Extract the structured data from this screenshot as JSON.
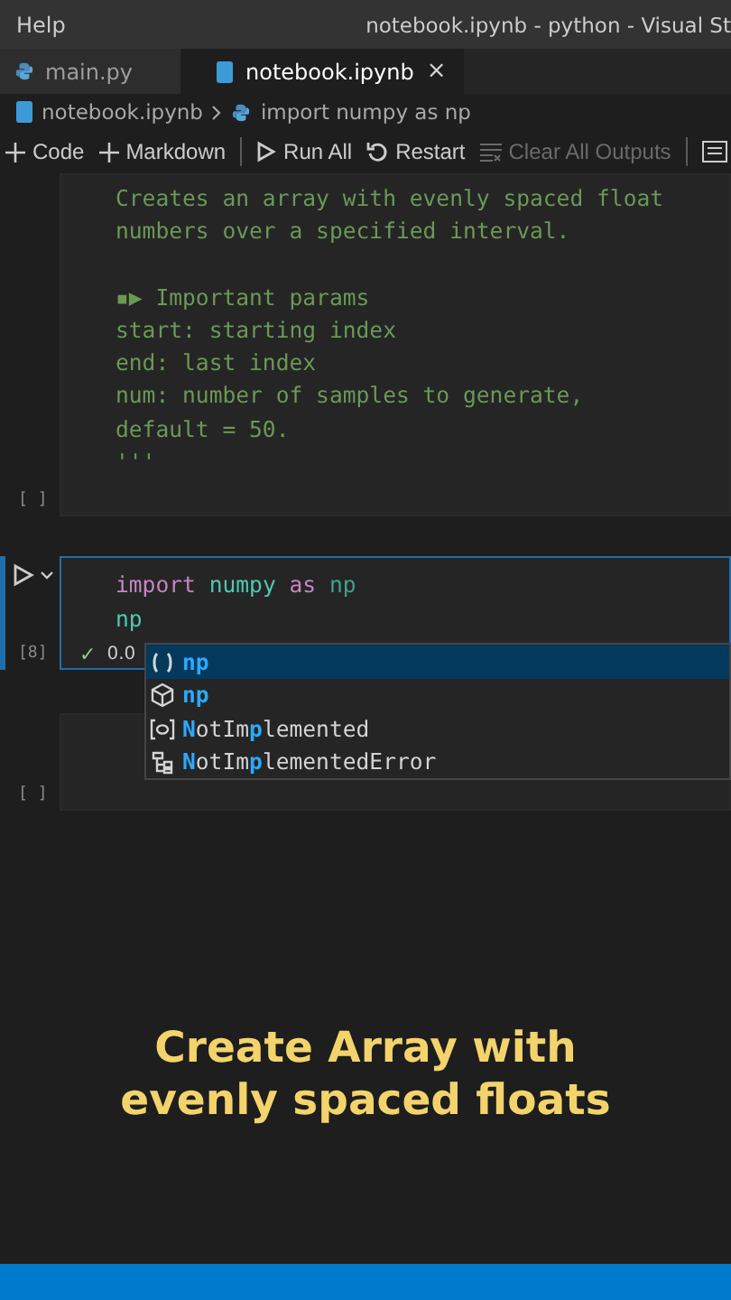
{
  "title_bar": {
    "menu": "Help",
    "title": "notebook.ipynb - python - Visual St"
  },
  "tabs": [
    {
      "label": "main.py",
      "kind": "python",
      "selected": false
    },
    {
      "label": "notebook.ipynb",
      "kind": "notebook",
      "selected": true,
      "close": "×"
    }
  ],
  "breadcrumb": [
    {
      "label": "notebook.ipynb",
      "kind": "notebook"
    },
    {
      "label": "import numpy as np",
      "kind": "python"
    }
  ],
  "toolbar": [
    {
      "kind": "add",
      "label": "Code",
      "disabled": false
    },
    {
      "kind": "add",
      "label": "Markdown",
      "disabled": false
    },
    {
      "kind": "separator"
    },
    {
      "kind": "run",
      "label": "Run All",
      "disabled": false
    },
    {
      "kind": "restart",
      "label": "Restart",
      "disabled": false
    },
    {
      "kind": "clear",
      "label": "Clear All Outputs",
      "disabled": true
    },
    {
      "kind": "separator"
    },
    {
      "kind": "variables"
    }
  ],
  "cells": [
    {
      "kind": "text",
      "paragraphs": [
        [
          "Creates an array with evenly spaced float",
          "numbers over a specified interval."
        ],
        [
          "▪▶ Important params",
          "start: starting index",
          "end: last index",
          "num: number of samples to generate,",
          "default = 50.",
          "'''"
        ]
      ],
      "count": "[ ]",
      "focused": false
    },
    {
      "kind": "code",
      "lines": [
        [
          {
            "text": "import ",
            "kind": "keyword"
          },
          {
            "text": "numpy ",
            "kind": "module"
          },
          {
            "text": "as ",
            "kind": "keyword"
          },
          {
            "text": "np",
            "kind": "alias"
          }
        ],
        [
          {
            "text": "np",
            "kind": "module"
          }
        ]
      ],
      "count": "[8]",
      "status": "✓",
      "time": "0.0",
      "focused": true,
      "suggestions": [
        {
          "kind": "function",
          "selected": true,
          "label": "**np**"
        },
        {
          "kind": "module",
          "selected": false,
          "label": "**np**"
        },
        {
          "kind": "variable",
          "selected": false,
          "label": "**N**otIm**p**lemented"
        },
        {
          "kind": "class",
          "selected": false,
          "label": "**N**otIm**p**lementedError"
        }
      ]
    },
    {
      "kind": "empty",
      "count": "[ ]",
      "focused": false
    }
  ],
  "caption": "Create Array with evenly spaced floats"
}
